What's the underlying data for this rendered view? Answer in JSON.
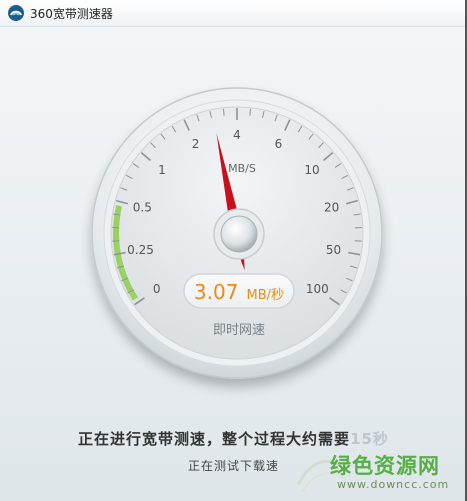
{
  "window": {
    "title": "360宽带测速器"
  },
  "gauge": {
    "unit": "MB/S",
    "ticks": [
      "0",
      "0.25",
      "0.5",
      "1",
      "2",
      "4",
      "6",
      "10",
      "20",
      "50",
      "100"
    ],
    "speed_value": "3.07",
    "speed_unit": "MB/秒",
    "caption": "即时网速",
    "needle_reading": 3.07,
    "colors": {
      "needle": "#c8101c",
      "value_text": "#ee8a15",
      "progress_arc": "#9bd162"
    }
  },
  "status": {
    "main_text": "正在进行宽带测速，整个过程大约需要",
    "main_text_faded": "15秒",
    "sub_text": "正在测试下载速"
  },
  "watermark": {
    "name": "绿色资源网",
    "url": "www.downcc.com"
  }
}
